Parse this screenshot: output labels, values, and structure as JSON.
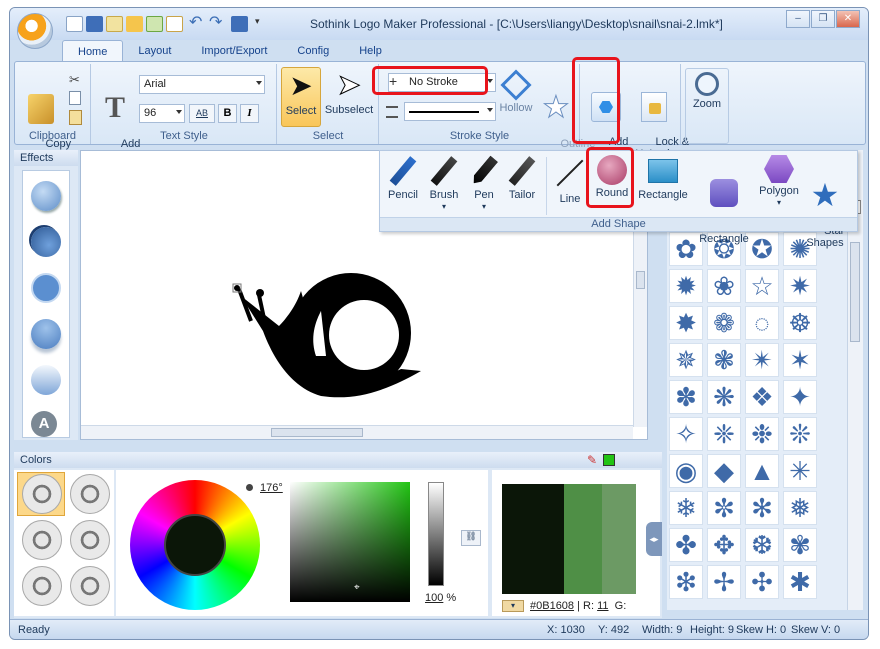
{
  "window": {
    "title": "Sothink Logo Maker Professional - [C:\\Users\\liangy\\Desktop\\snail\\snai-2.lmk*]"
  },
  "tabs": [
    "Home",
    "Layout",
    "Import/Export",
    "Config",
    "Help"
  ],
  "ribbon": {
    "clipboard": {
      "copy_format": "Copy\nFormat",
      "label": "Clipboard"
    },
    "text_style": {
      "add_text": "Add\nText",
      "font": "Arial",
      "size": "96",
      "bold": "B",
      "italic": "I",
      "ab": "AB",
      "label": "Text Style"
    },
    "select": {
      "select": "Select",
      "subselect": "Subselect",
      "label": "Select"
    },
    "stroke": {
      "value": "No Stroke",
      "hollow": "Hollow",
      "outline_fill": "Outline\nFill",
      "label": "Stroke Style"
    },
    "add_shape": "Add\nShape",
    "lock": "Lock &\nUnLock",
    "zoom": "Zoom"
  },
  "dropdown": {
    "items": [
      "Pencil",
      "Brush",
      "Pen",
      "Tailor",
      "Line",
      "Round",
      "Rectangle",
      "Rounded\nRectangle",
      "Polygon",
      "Star\nShapes"
    ],
    "label": "Add Shape"
  },
  "effects_panel": {
    "title": "Effects"
  },
  "colors_panel": {
    "title": "Colors",
    "angle": "176°",
    "brightness": "100",
    "brightness_unit": "%",
    "hex": "#0B1608",
    "r_label": "R:",
    "r_value": "11",
    "g_label": "G:"
  },
  "status": {
    "ready": "Ready",
    "x": "X: 1030",
    "y": "Y: 492",
    "width": "Width: 9",
    "height": "Height: 9",
    "skew_h": "Skew H: 0",
    "skew_v": "Skew V: 0"
  },
  "colors": {
    "shape_blue": "#3f6aa8",
    "highlight": "#e8141c",
    "accent_green": "#22c414"
  }
}
